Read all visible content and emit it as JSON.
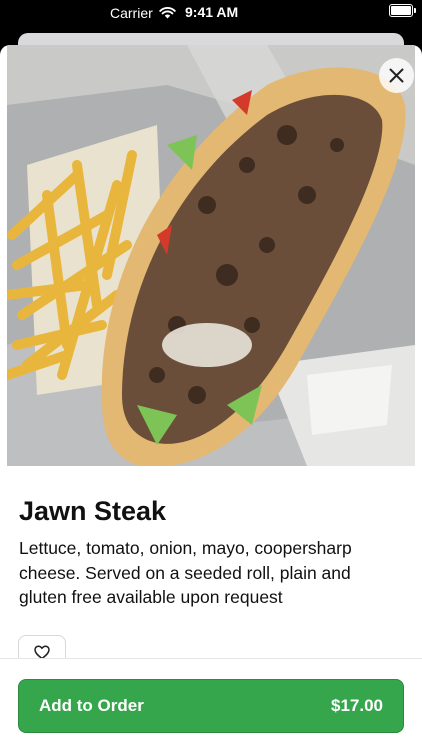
{
  "status_bar": {
    "carrier": "Carrier",
    "time": "9:41 AM"
  },
  "item": {
    "title": "Jawn Steak",
    "description": "Lettuce, tomato, onion, mayo, coopersharp cheese. Served on a seeded roll, plain and gluten free available upon request"
  },
  "order_button": {
    "label": "Add to Order",
    "price": "$17.00"
  },
  "icons": {
    "close": "close-icon",
    "favorite": "heart-icon",
    "wifi": "wifi-icon",
    "battery": "battery-icon"
  },
  "colors": {
    "accent": "#36a64d",
    "text": "#111111"
  }
}
